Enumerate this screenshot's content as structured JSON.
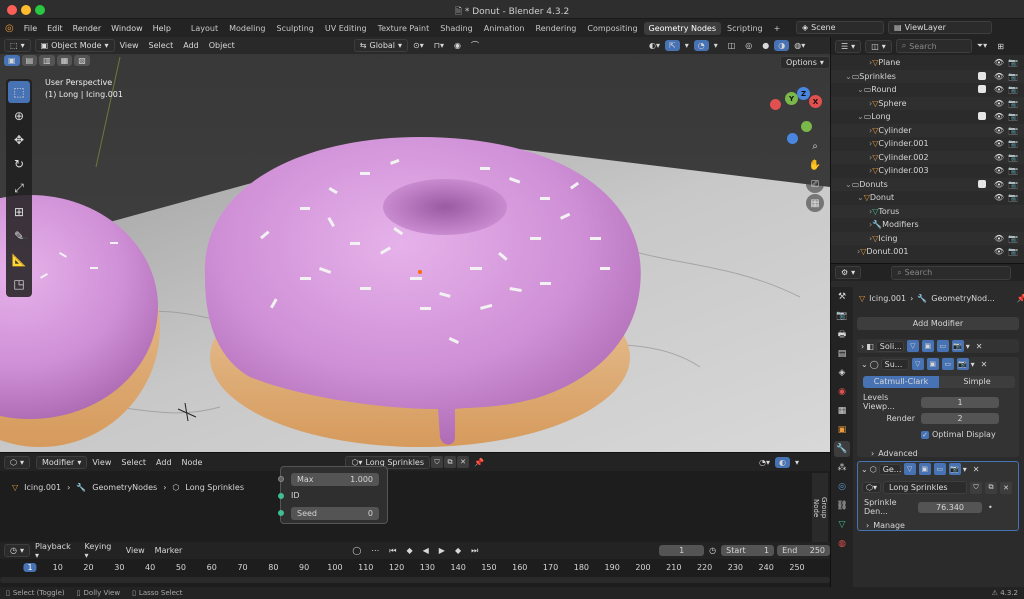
{
  "window": {
    "title": "* Donut - Blender 4.3.2"
  },
  "menu": [
    "File",
    "Edit",
    "Render",
    "Window",
    "Help"
  ],
  "workspaces": [
    "Layout",
    "Modeling",
    "Sculpting",
    "UV Editing",
    "Texture Paint",
    "Shading",
    "Animation",
    "Rendering",
    "Compositing",
    "Geometry Nodes",
    "Scripting"
  ],
  "workspace_active": "Geometry Nodes",
  "workspace_add": "+",
  "scene": {
    "label": "Scene",
    "viewlayer": "ViewLayer"
  },
  "viewport": {
    "mode": "Object Mode",
    "menus": [
      "View",
      "Select",
      "Add",
      "Object"
    ],
    "transform": "Global",
    "options": "Options",
    "overlay_line1": "User Perspective",
    "overlay_line2": "(1) Long | Icing.001",
    "gizmo": {
      "x": "X",
      "y": "Y",
      "z": "Z"
    }
  },
  "outliner": {
    "search_placeholder": "Search",
    "items": [
      {
        "label": "Plane",
        "depth": 2,
        "icon": "mesh"
      },
      {
        "label": "Sprinkles",
        "depth": 0,
        "icon": "collection"
      },
      {
        "label": "Round",
        "depth": 1,
        "icon": "collection"
      },
      {
        "label": "Sphere",
        "depth": 2,
        "icon": "mesh"
      },
      {
        "label": "Long",
        "depth": 1,
        "icon": "collection"
      },
      {
        "label": "Cylinder",
        "depth": 2,
        "icon": "mesh"
      },
      {
        "label": "Cylinder.001",
        "depth": 2,
        "icon": "mesh"
      },
      {
        "label": "Cylinder.002",
        "depth": 2,
        "icon": "mesh"
      },
      {
        "label": "Cylinder.003",
        "depth": 2,
        "icon": "mesh"
      },
      {
        "label": "Donuts",
        "depth": 0,
        "icon": "collection"
      },
      {
        "label": "Donut",
        "depth": 1,
        "icon": "mesh"
      },
      {
        "label": "Torus",
        "depth": 2,
        "icon": "data"
      },
      {
        "label": "Modifiers",
        "depth": 2,
        "icon": "wrench"
      },
      {
        "label": "Icing",
        "depth": 2,
        "icon": "mesh"
      },
      {
        "label": "Donut.001",
        "depth": 1,
        "icon": "mesh"
      }
    ]
  },
  "properties": {
    "search_placeholder": "Search",
    "object": "Icing.001",
    "modifier_crumb": "GeometryNod...",
    "add_modifier": "Add Modifier",
    "solidify": "Soli...",
    "subsurf": "Su...",
    "subsurf_tabs": [
      "Catmull-Clark",
      "Simple"
    ],
    "levels_label": "Levels Viewp...",
    "levels_value": "1",
    "render_label": "Render",
    "render_value": "2",
    "optimal_display": "Optimal Display",
    "advanced": "Advanced",
    "geonodes": "Ge...",
    "node_group": "Long Sprinkles",
    "sprinkle_label": "Sprinkle Den...",
    "sprinkle_value": "76.340",
    "manage": "Manage"
  },
  "node_editor": {
    "type": "Modifier",
    "menus": [
      "View",
      "Select",
      "Add",
      "Node"
    ],
    "node_group": "Long Sprinkles",
    "crumbs": [
      "Icing.001",
      "GeometryNodes",
      "Long Sprinkles"
    ],
    "fields": {
      "max_label": "Max",
      "max_value": "1.000",
      "id_label": "ID",
      "seed_label": "Seed",
      "seed_value": "0"
    },
    "side_tabs": [
      "Group",
      "Node"
    ]
  },
  "timeline": {
    "menus": [
      "Playback",
      "Keying",
      "View",
      "Marker"
    ],
    "current_frame": "1",
    "start_label": "Start",
    "start_value": "1",
    "end_label": "End",
    "end_value": "250",
    "ticks": [
      "1",
      "10",
      "20",
      "30",
      "40",
      "50",
      "60",
      "70",
      "80",
      "90",
      "100",
      "110",
      "120",
      "130",
      "140",
      "150",
      "160",
      "170",
      "180",
      "190",
      "200",
      "210",
      "220",
      "230",
      "240",
      "250"
    ]
  },
  "status": {
    "items": [
      "Select (Toggle)",
      "Dolly View",
      "Lasso Select"
    ],
    "version": "4.3.2"
  }
}
